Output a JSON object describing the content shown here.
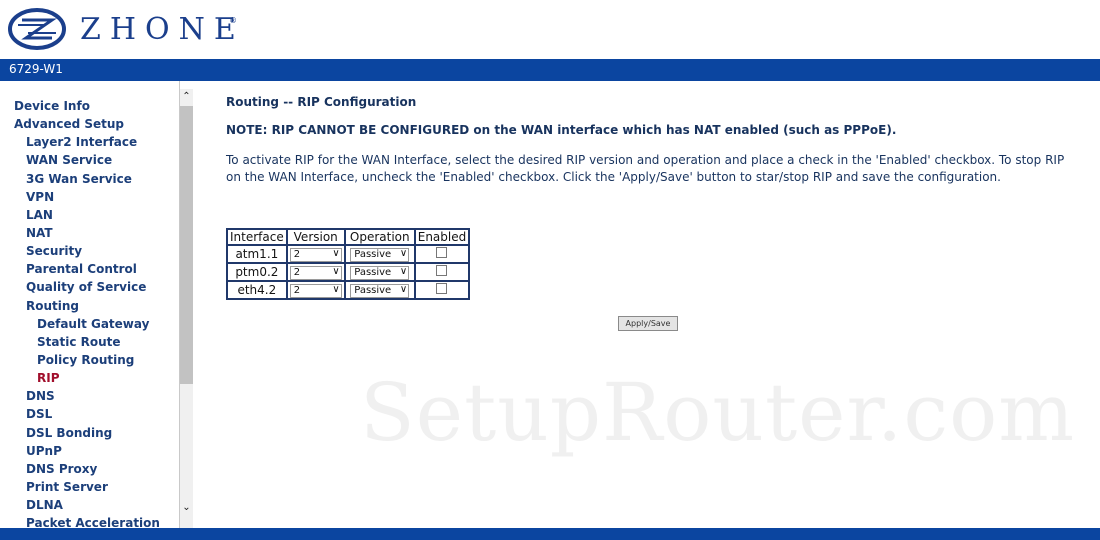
{
  "header": {
    "brand": "ZHONE",
    "trademark": "®",
    "model": "6729-W1"
  },
  "sidebar": {
    "items": [
      {
        "label": "Device Info"
      },
      {
        "label": "Advanced Setup"
      },
      {
        "label": "Layer2 Interface"
      },
      {
        "label": "WAN Service"
      },
      {
        "label": "3G Wan Service"
      },
      {
        "label": "VPN"
      },
      {
        "label": "LAN"
      },
      {
        "label": "NAT"
      },
      {
        "label": "Security"
      },
      {
        "label": "Parental Control"
      },
      {
        "label": "Quality of Service"
      },
      {
        "label": "Routing"
      },
      {
        "label": "Default Gateway"
      },
      {
        "label": "Static Route"
      },
      {
        "label": "Policy Routing"
      },
      {
        "label": "RIP"
      },
      {
        "label": "DNS"
      },
      {
        "label": "DSL"
      },
      {
        "label": "DSL Bonding"
      },
      {
        "label": "UPnP"
      },
      {
        "label": "DNS Proxy"
      },
      {
        "label": "Print Server"
      },
      {
        "label": "DLNA"
      },
      {
        "label": "Packet Acceleration"
      }
    ],
    "active": "RIP",
    "scroll_up_icon": "chevron-up-icon",
    "scroll_down_icon": "chevron-down-icon"
  },
  "main": {
    "title": "Routing -- RIP Configuration",
    "note": "NOTE: RIP CANNOT BE CONFIGURED on the WAN interface which has NAT enabled (such as PPPoE).",
    "description": "To activate RIP for the WAN Interface, select the desired RIP version and operation and place a check in the 'Enabled' checkbox. To stop RIP on the WAN Interface, uncheck the 'Enabled' checkbox. Click the 'Apply/Save' button to star/stop RIP and save the configuration."
  },
  "table": {
    "headers": [
      "Interface",
      "Version",
      "Operation",
      "Enabled"
    ],
    "rows": [
      {
        "interface": "atm1.1",
        "version": "2",
        "operation": "Passive",
        "enabled": false
      },
      {
        "interface": "ptm0.2",
        "version": "2",
        "operation": "Passive",
        "enabled": false
      },
      {
        "interface": "eth4.2",
        "version": "2",
        "operation": "Passive",
        "enabled": false
      }
    ]
  },
  "buttons": {
    "apply_save": "Apply/Save"
  },
  "watermark": "SetupRouter.com",
  "colors": {
    "brand_blue": "#0b45a0",
    "logo_blue": "#1b3f8c",
    "nav_text": "#1c3f7a",
    "active_nav": "#a10e2b"
  }
}
